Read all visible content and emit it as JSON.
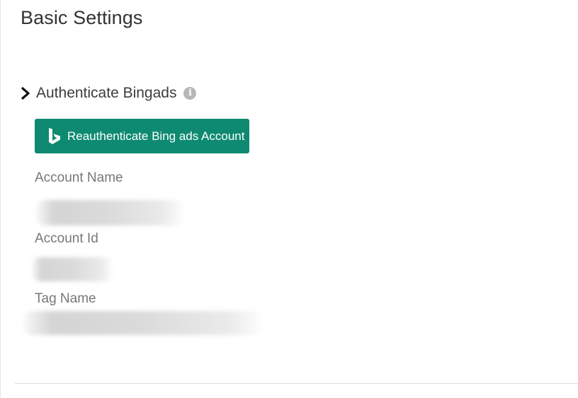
{
  "page": {
    "title": "Basic Settings"
  },
  "section": {
    "title": "Authenticate Bingads",
    "chevron_icon": "chevron-right-icon",
    "info_icon": "info-icon",
    "info_glyph": "i"
  },
  "reauth_button": {
    "label": "Reauthenticate Bing ads Account",
    "icon": "bing-logo-icon",
    "color": "#0f8a72"
  },
  "fields": {
    "account_name_label": "Account Name",
    "account_id_label": "Account Id",
    "tag_name_label": "Tag Name"
  }
}
